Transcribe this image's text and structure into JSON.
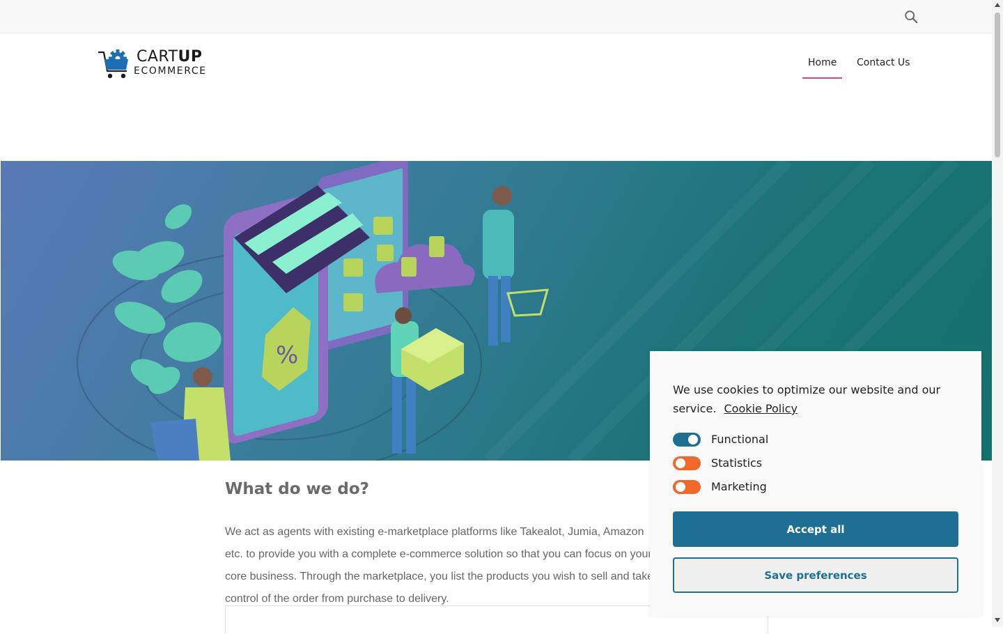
{
  "topbar": {
    "search_icon": "search-icon"
  },
  "logo": {
    "brand_light": "CART",
    "brand_bold": "UP",
    "tagline": "ECOMMERCE",
    "icon": "cart-gear-icon",
    "colors": {
      "blue": "#1d6fb3",
      "text": "#1b1b1b"
    }
  },
  "nav": {
    "items": [
      {
        "label": "Home",
        "active": true
      },
      {
        "label": "Contact Us",
        "active": false
      }
    ],
    "active_color": "#d9497a"
  },
  "hero": {
    "illustration": "online-shopping-illustration",
    "gradient": [
      "#5a79b7",
      "#14706c"
    ]
  },
  "main": {
    "heading": "What do we do?",
    "paragraph": "We act as agents with existing e-marketplace platforms like Takealot, Jumia, Amazon etc. to provide you with a complete e-commerce solution so that you can focus on your core business. Through the marketplace, you list the products you wish to sell and take control of the order from purchase to delivery."
  },
  "cookie_banner": {
    "message": "We use cookies to optimize our website and our service.",
    "policy_link": "Cookie Policy",
    "toggles": [
      {
        "label": "Functional",
        "on": true,
        "color": "#1e6f92"
      },
      {
        "label": "Statistics",
        "on": false,
        "color": "#f0692a"
      },
      {
        "label": "Marketing",
        "on": false,
        "color": "#f0692a"
      }
    ],
    "accept_label": "Accept all",
    "save_label": "Save preferences",
    "primary_color": "#1e6f92"
  }
}
